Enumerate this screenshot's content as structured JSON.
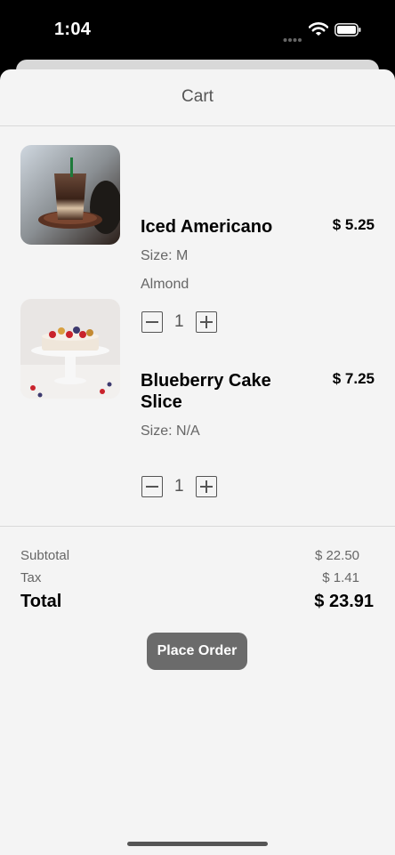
{
  "status_bar": {
    "time": "1:04"
  },
  "header": {
    "title": "Cart"
  },
  "items": [
    {
      "name": "Iced Americano",
      "price": "$ 5.25",
      "size": "Size: M",
      "option": "Almond",
      "quantity": "1",
      "image_icon": "iced-coffee-photo"
    },
    {
      "name": "Blueberry Cake Slice",
      "price": "$ 7.25",
      "size": "Size: N/A",
      "quantity": "1",
      "image_icon": "cake-photo"
    }
  ],
  "summary": {
    "subtotal_label": "Subtotal",
    "subtotal_value": "$ 22.50",
    "tax_label": "Tax",
    "tax_value": "$ 1.41",
    "total_label": "Total",
    "total_value": "$ 23.91"
  },
  "actions": {
    "place_order_label": "Place Order"
  },
  "colors": {
    "sheet_bg": "#f4f4f4",
    "button_bg": "#6b6b6b",
    "status_bar_bg": "#000000"
  }
}
